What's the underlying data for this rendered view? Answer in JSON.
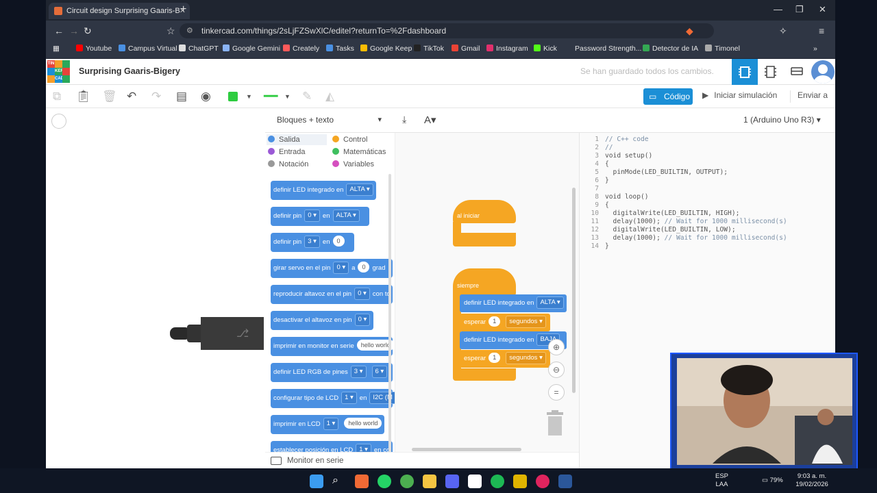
{
  "browser": {
    "tab_title": "Circuit design Surprising Gaaris-B",
    "tab_close": "✕",
    "new_tab": "+",
    "url": "tinkercad.com/things/2sLjFZSwXlC/editel?returnTo=%2Fdashboard",
    "bookmarks": [
      {
        "label": "Youtube",
        "color": "#ff0000"
      },
      {
        "label": "Campus Virtual",
        "color": "#4a90e2"
      },
      {
        "label": "ChatGPT",
        "color": "#dddddd"
      },
      {
        "label": "Google Gemini",
        "color": "#8ab4f8"
      },
      {
        "label": "Creately",
        "color": "#ff5a5a"
      },
      {
        "label": "Tasks",
        "color": "#4a90e2"
      },
      {
        "label": "Google Keep",
        "color": "#fbbc04"
      },
      {
        "label": "TikTok",
        "color": "#222222"
      },
      {
        "label": "Gmail",
        "color": "#ea4335"
      },
      {
        "label": "Instagram",
        "color": "#e1306c"
      },
      {
        "label": "Kick",
        "color": "#53fc18"
      },
      {
        "label": "Password Strength...",
        "color": "#2f3644"
      },
      {
        "label": "Detector de IA",
        "color": "#34a853"
      },
      {
        "label": "Timonel",
        "color": "#aaaaaa"
      }
    ]
  },
  "app": {
    "logo_letters": [
      "TIN",
      "KER",
      "CAD"
    ],
    "project_title": "Surprising Gaaris-Bigery",
    "save_status": "Se han guardado todos los cambios.",
    "code_button": "Código",
    "simulate_button": "Iniciar simulación",
    "send_button": "Enviar a"
  },
  "code_panel": {
    "mode_dropdown": "Bloques + texto",
    "device_dropdown": "1 (Arduino Uno R3)",
    "footer": "Monitor en serie",
    "categories": [
      {
        "label": "Salida",
        "color": "#4a90e2"
      },
      {
        "label": "Control",
        "color": "#f5a623"
      },
      {
        "label": "Entrada",
        "color": "#9b59d6"
      },
      {
        "label": "Matemáticas",
        "color": "#3fbf5f"
      },
      {
        "label": "Notación",
        "color": "#999999"
      },
      {
        "label": "Variables",
        "color": "#d54fbf"
      }
    ],
    "palette_blocks": [
      {
        "text": "definir LED integrado en",
        "p1": "ALTA"
      },
      {
        "text": "definir pin",
        "p1": "0",
        "mid": "en",
        "p2": "ALTA"
      },
      {
        "text": "definir pin",
        "p1": "3",
        "mid": "en",
        "r1": "0"
      },
      {
        "text": "girar servo en el pin",
        "p1": "0",
        "mid": "a",
        "r1": "0",
        "tail": "grad"
      },
      {
        "text": "reproducir altavoz en el pin",
        "p1": "0",
        "tail": "con to"
      },
      {
        "text": "desactivar el altavoz en pin",
        "p1": "0"
      },
      {
        "text": "imprimir en monitor en serie",
        "r1": "hello world"
      },
      {
        "text": "definir LED RGB de pines",
        "p1": "3",
        "p2": "6"
      },
      {
        "text": "configurar tipo de LCD",
        "p1": "1",
        "mid": "en",
        "tail": "I2C (M"
      },
      {
        "text": "imprimir en LCD",
        "p1": "1",
        "r1": "hello world"
      },
      {
        "text": "establecer posición en LCD",
        "p1": "1",
        "tail": "en col"
      }
    ],
    "canvas": {
      "start_hat": "al iniciar",
      "forever_hat": "siempre",
      "b1": "definir LED integrado en",
      "b1v": "ALTA",
      "b2": "esperar",
      "b2n": "1",
      "b2u": "segundos",
      "b3": "definir LED integrado en",
      "b3v": "BAJA",
      "b4": "esperar",
      "b4n": "1",
      "b4u": "segundos"
    },
    "code_lines": [
      "// C++ code",
      "//",
      "void setup()",
      "{",
      "  pinMode(LED_BUILTIN, OUTPUT);",
      "}",
      "",
      "void loop()",
      "{",
      "  digitalWrite(LED_BUILTIN, HIGH);",
      "  delay(1000); // Wait for 1000 millisecond(s)",
      "  digitalWrite(LED_BUILTIN, LOW);",
      "  delay(1000); // Wait for 1000 millisecond(s)",
      "}"
    ],
    "line_numbers": [
      "1",
      "2",
      "3",
      "4",
      "5",
      "6",
      "7",
      "8",
      "9",
      "10",
      "11",
      "12",
      "13",
      "14"
    ]
  },
  "taskbar": {
    "lang": "ESP",
    "lang2": "LAA",
    "battery": "79%",
    "time": "9:03 a. m.",
    "date": "19/02/2026"
  }
}
